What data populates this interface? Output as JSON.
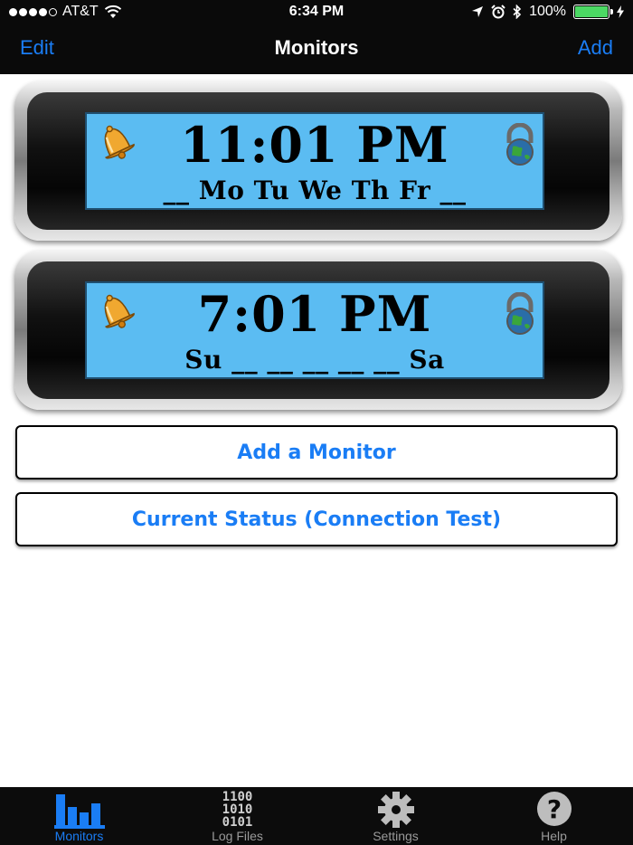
{
  "status_bar": {
    "carrier": "AT&T",
    "time": "6:34 PM",
    "battery_percent": "100%",
    "battery_level": 1.0,
    "signal_bars_filled": 4,
    "signal_bars_total": 5
  },
  "nav": {
    "left_button": "Edit",
    "title": "Monitors",
    "right_button": "Add"
  },
  "monitors": [
    {
      "time": "11:01 PM",
      "days": "__ Mo Tu We Th Fr __"
    },
    {
      "time": "7:01 PM",
      "days": "Su __ __ __ __ __ Sa"
    }
  ],
  "buttons": {
    "add_monitor": "Add a Monitor",
    "current_status": "Current Status (Connection Test)"
  },
  "tabs": [
    {
      "label": "Monitors",
      "icon": "bar-chart-icon",
      "active": true
    },
    {
      "label": "Log Files",
      "icon": "binary-icon",
      "binary": "1100\n1010\n0101",
      "active": false
    },
    {
      "label": "Settings",
      "icon": "gear-icon",
      "active": false
    },
    {
      "label": "Help",
      "icon": "question-icon",
      "active": false
    }
  ],
  "colors": {
    "accent": "#1a7df5",
    "screen": "#5bbcf2",
    "bar_background": "#0a0a0a",
    "battery": "#4cd964"
  }
}
